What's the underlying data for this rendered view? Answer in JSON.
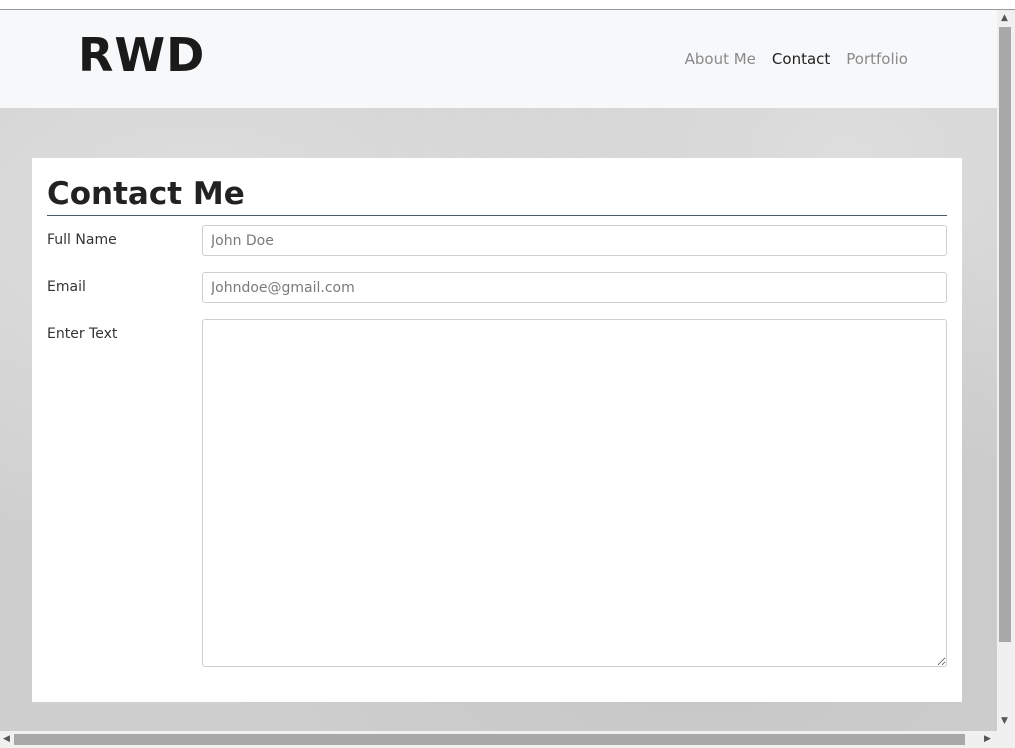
{
  "brand": "RWD",
  "nav": {
    "items": [
      {
        "label": "About Me"
      },
      {
        "label": "Contact"
      },
      {
        "label": "Portfolio"
      }
    ]
  },
  "form": {
    "title": "Contact Me",
    "full_name": {
      "label": "Full Name",
      "placeholder": "John Doe"
    },
    "email": {
      "label": "Email",
      "placeholder": "Johndoe@gmail.com"
    },
    "text": {
      "label": "Enter Text",
      "value": ""
    }
  },
  "colors": {
    "navbar_bg": "#f7f8fa",
    "rule": "#4e5d6c",
    "nav_active": "#222222",
    "nav_inactive": "#8a8a8a"
  }
}
